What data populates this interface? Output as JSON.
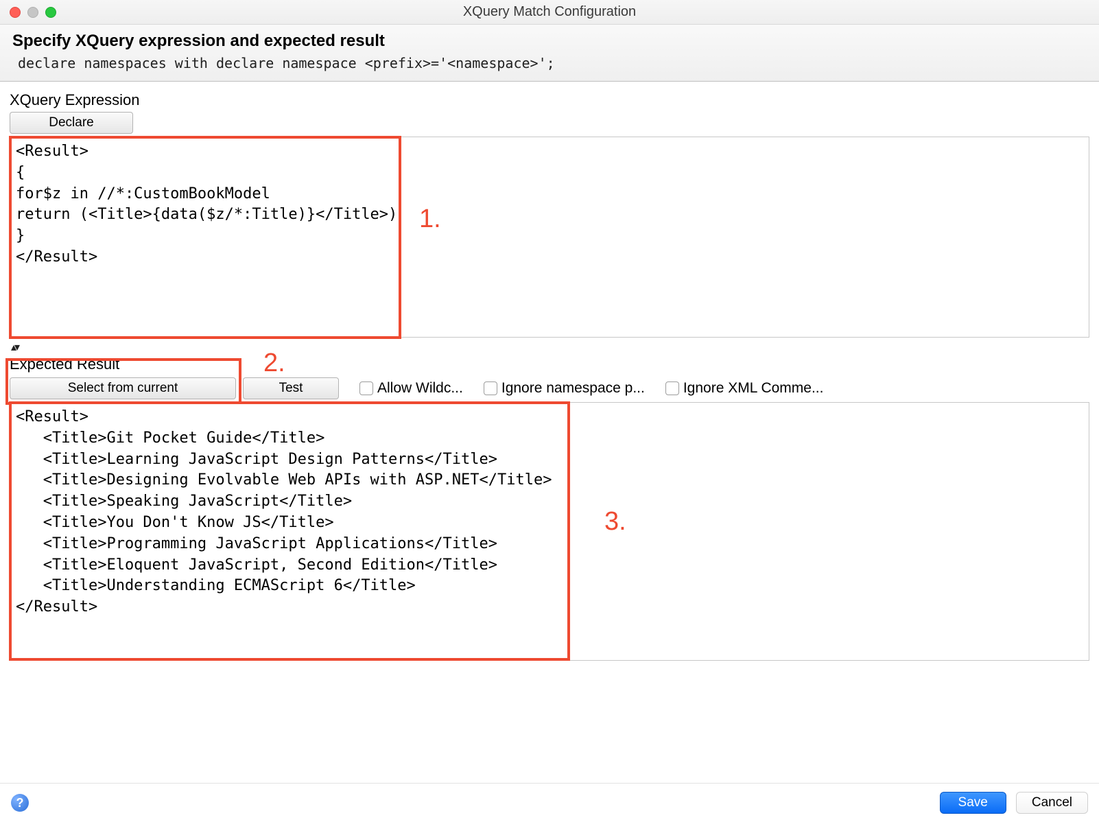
{
  "window": {
    "title": "XQuery Match Configuration"
  },
  "header": {
    "title": "Specify XQuery expression and expected result",
    "subtitle": "declare namespaces with declare namespace <prefix>='<namespace>';"
  },
  "expression": {
    "label": "XQuery Expression",
    "declare_button": "Declare",
    "text": "<Result>\n{\nfor$z in //*:CustomBookModel\nreturn (<Title>{data($z/*:Title)}</Title>)\n}\n</Result>"
  },
  "expected": {
    "label": "Expected Result",
    "select_button": "Select from current",
    "test_button": "Test",
    "checkboxes": {
      "allow_wildcards": "Allow Wildc...",
      "ignore_namespace": "Ignore namespace p...",
      "ignore_comments": "Ignore XML Comme..."
    },
    "text": "<Result>\n   <Title>Git Pocket Guide</Title>\n   <Title>Learning JavaScript Design Patterns</Title>\n   <Title>Designing Evolvable Web APIs with ASP.NET</Title>\n   <Title>Speaking JavaScript</Title>\n   <Title>You Don't Know JS</Title>\n   <Title>Programming JavaScript Applications</Title>\n   <Title>Eloquent JavaScript, Second Edition</Title>\n   <Title>Understanding ECMAScript 6</Title>\n</Result>"
  },
  "footer": {
    "save": "Save",
    "cancel": "Cancel"
  },
  "annotations": {
    "a1": "1.",
    "a2": "2.",
    "a3": "3."
  }
}
